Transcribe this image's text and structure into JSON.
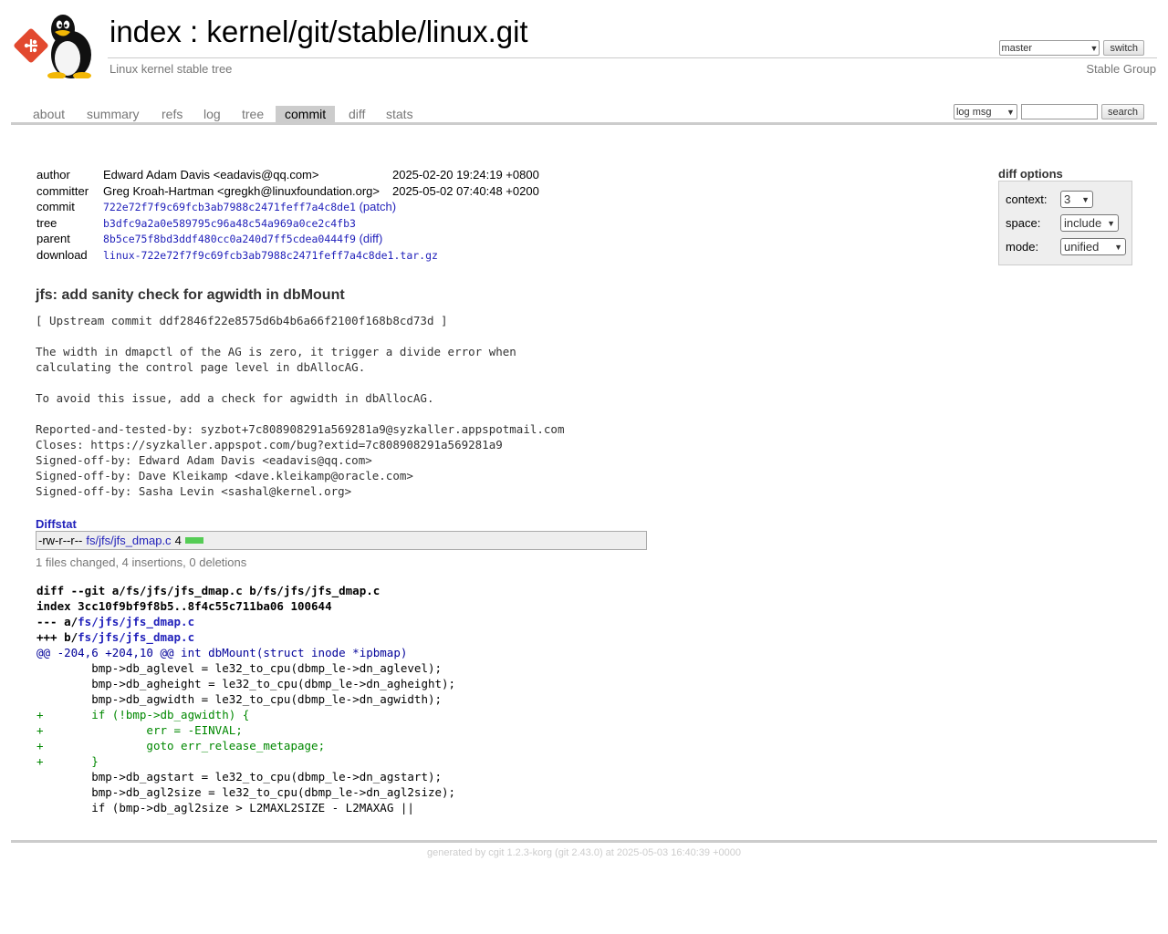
{
  "header": {
    "index_link": "index",
    "separator": " : ",
    "repo_path": "kernel/git/stable/linux.git",
    "description": "Linux kernel stable tree",
    "owner": "Stable Group",
    "branch_selected": "master",
    "switch_label": "switch"
  },
  "tabs": [
    {
      "label": "about"
    },
    {
      "label": "summary"
    },
    {
      "label": "refs"
    },
    {
      "label": "log"
    },
    {
      "label": "tree"
    },
    {
      "label": "commit",
      "active": true
    },
    {
      "label": "diff"
    },
    {
      "label": "stats"
    }
  ],
  "search": {
    "type_selected": "log msg",
    "query": "",
    "button_label": "search"
  },
  "commit_info": {
    "author_label": "author",
    "author": "Edward Adam Davis <eadavis@qq.com>",
    "author_date": "2025-02-20 19:24:19 +0800",
    "committer_label": "committer",
    "committer": "Greg Kroah-Hartman <gregkh@linuxfoundation.org>",
    "committer_date": "2025-05-02 07:40:48 +0200",
    "commit_label": "commit",
    "commit_sha": "722e72f7f9c69fcb3ab7988c2471feff7a4c8de1",
    "patch_label": "patch",
    "tree_label": "tree",
    "tree_sha": "b3dfc9a2a0e589795c96a48c54a969a0ce2c4fb3",
    "parent_label": "parent",
    "parent_sha": "8b5ce75f8bd3ddf480cc0a240d7ff5cdea0444f9",
    "diff_label": "diff",
    "download_label": "download",
    "download_file": "linux-722e72f7f9c69fcb3ab7988c2471feff7a4c8de1.tar.gz"
  },
  "diff_options": {
    "title": "diff options",
    "context_label": "context:",
    "context_value": "3",
    "space_label": "space:",
    "space_value": "include",
    "mode_label": "mode:",
    "mode_value": "unified"
  },
  "subject": "jfs: add sanity check for agwidth in dbMount",
  "message": "[ Upstream commit ddf2846f22e8575d6b4b6a66f2100f168b8cd73d ]\n\nThe width in dmapctl of the AG is zero, it trigger a divide error when\ncalculating the control page level in dbAllocAG.\n\nTo avoid this issue, add a check for agwidth in dbAllocAG.\n\nReported-and-tested-by: syzbot+7c808908291a569281a9@syzkaller.appspotmail.com\nCloses: https://syzkaller.appspot.com/bug?extid=7c808908291a569281a9\nSigned-off-by: Edward Adam Davis <eadavis@qq.com>\nSigned-off-by: Dave Kleikamp <dave.kleikamp@oracle.com>\nSigned-off-by: Sasha Levin <sashal@kernel.org>",
  "diffstat": {
    "header": "Diffstat",
    "mode": "-rw-r--r--",
    "file": "fs/jfs/jfs_dmap.c",
    "count": "4",
    "summary": "1 files changed, 4 insertions, 0 deletions"
  },
  "diff": {
    "head_line": "diff --git a/fs/jfs/jfs_dmap.c b/fs/jfs/jfs_dmap.c",
    "index_line": "index 3cc10f9bf9f8b5..8f4c55c711ba06 100644",
    "minus_prefix": "--- a/",
    "plus_prefix": "+++ b/",
    "file": "fs/jfs/jfs_dmap.c",
    "hunk": "@@ -204,6 +204,10 @@ int dbMount(struct inode *ipbmap)",
    "lines": [
      {
        "type": "ctx",
        "text": " \tbmp->db_aglevel = le32_to_cpu(dbmp_le->dn_aglevel);"
      },
      {
        "type": "ctx",
        "text": " \tbmp->db_agheight = le32_to_cpu(dbmp_le->dn_agheight);"
      },
      {
        "type": "ctx",
        "text": " \tbmp->db_agwidth = le32_to_cpu(dbmp_le->dn_agwidth);"
      },
      {
        "type": "add",
        "text": "+\tif (!bmp->db_agwidth) {"
      },
      {
        "type": "add",
        "text": "+\t\terr = -EINVAL;"
      },
      {
        "type": "add",
        "text": "+\t\tgoto err_release_metapage;"
      },
      {
        "type": "add",
        "text": "+\t}"
      },
      {
        "type": "ctx",
        "text": " \tbmp->db_agstart = le32_to_cpu(dbmp_le->dn_agstart);"
      },
      {
        "type": "ctx",
        "text": " \tbmp->db_agl2size = le32_to_cpu(dbmp_le->dn_agl2size);"
      },
      {
        "type": "ctx",
        "text": " \tif (bmp->db_agl2size > L2MAXL2SIZE - L2MAXAG ||"
      }
    ]
  },
  "footer": "generated by cgit 1.2.3-korg (git 2.43.0) at 2025-05-03 16:40:39 +0000"
}
